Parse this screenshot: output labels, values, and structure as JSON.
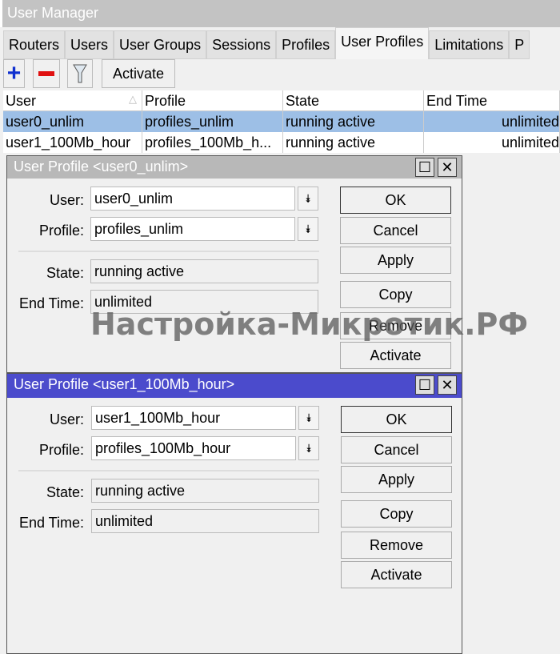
{
  "app_title": "User Manager",
  "tabs": [
    "Routers",
    "Users",
    "User Groups",
    "Sessions",
    "Profiles",
    "User Profiles",
    "Limitations",
    "P"
  ],
  "toolbar": {
    "add_icon": "plus-icon",
    "remove_icon": "minus-icon",
    "filter_icon": "filter-icon",
    "activate": "Activate"
  },
  "table": {
    "columns": [
      "User",
      "Profile",
      "State",
      "End Time"
    ],
    "rows": [
      [
        "user0_unlim",
        "profiles_unlim",
        "running active",
        "unlimited"
      ],
      [
        "user1_100Mb_hour",
        "profiles_100Mb_h...",
        "running active",
        "unlimited"
      ]
    ]
  },
  "dialogs": [
    {
      "title": "User Profile <user0_unlim>",
      "labels": {
        "user": "User:",
        "profile": "Profile:",
        "state": "State:",
        "end_time": "End Time:"
      },
      "user": "user0_unlim",
      "profile": "profiles_unlim",
      "state": "running active",
      "end_time": "unlimited",
      "buttons": [
        "OK",
        "Cancel",
        "Apply",
        "Copy",
        "Remove",
        "Activate"
      ]
    },
    {
      "title": "User Profile <user1_100Mb_hour>",
      "labels": {
        "user": "User:",
        "profile": "Profile:",
        "state": "State:",
        "end_time": "End Time:"
      },
      "user": "user1_100Mb_hour",
      "profile": "profiles_100Mb_hour",
      "state": "running active",
      "end_time": "unlimited",
      "buttons": [
        "OK",
        "Cancel",
        "Apply",
        "Copy",
        "Remove",
        "Activate"
      ]
    }
  ],
  "watermark": "Настройка-Микротик.РФ",
  "colors": {
    "selected_row": "#9dbfe6",
    "active_title": "#4b4bcc",
    "inactive_title": "#b8b8b8"
  }
}
